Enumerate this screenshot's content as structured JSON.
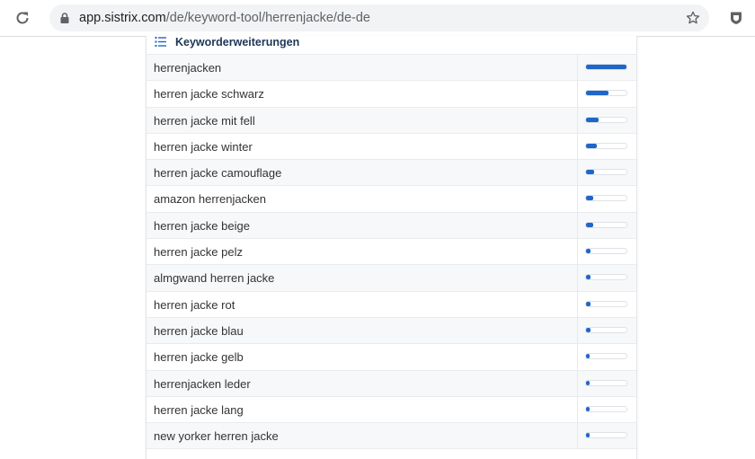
{
  "browser": {
    "url_host": "app.sistrix.com",
    "url_path": "/de/keyword-tool/herrenjacke/de-de"
  },
  "panel": {
    "title": "Keyworderweiterungen"
  },
  "colors": {
    "bar_fill": "#1f66c9",
    "title": "#1d3557"
  },
  "keywords": [
    {
      "label": "herrenjacken",
      "share": 1.0
    },
    {
      "label": "herren jacke schwarz",
      "share": 0.55
    },
    {
      "label": "herren jacke mit fell",
      "share": 0.32
    },
    {
      "label": "herren jacke winter",
      "share": 0.27
    },
    {
      "label": "herren jacke camouflage",
      "share": 0.2
    },
    {
      "label": "amazon herrenjacken",
      "share": 0.17
    },
    {
      "label": "herren jacke beige",
      "share": 0.17
    },
    {
      "label": "herren jacke pelz",
      "share": 0.11
    },
    {
      "label": "almgwand herren jacke",
      "share": 0.11
    },
    {
      "label": "herren jacke rot",
      "share": 0.11
    },
    {
      "label": "herren jacke blau",
      "share": 0.1
    },
    {
      "label": "herren jacke gelb",
      "share": 0.09
    },
    {
      "label": "herrenjacken leder",
      "share": 0.08
    },
    {
      "label": "herren jacke lang",
      "share": 0.08
    },
    {
      "label": "new yorker herren jacke",
      "share": 0.08
    }
  ]
}
